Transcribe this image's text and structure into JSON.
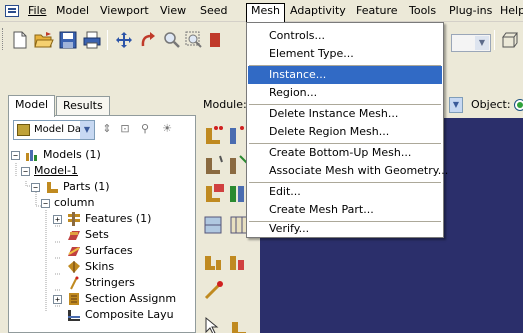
{
  "menubar": {
    "items": [
      {
        "label": "File"
      },
      {
        "label": "Model"
      },
      {
        "label": "Viewport"
      },
      {
        "label": "View"
      },
      {
        "label": "Seed"
      },
      {
        "label": "Mesh"
      },
      {
        "label": "Adaptivity"
      },
      {
        "label": "Feature"
      },
      {
        "label": "Tools"
      },
      {
        "label": "Plug-ins"
      },
      {
        "label": "Help"
      }
    ]
  },
  "mesh_menu": {
    "items": [
      {
        "label": "Controls..."
      },
      {
        "label": "Element Type..."
      },
      {
        "label": "Instance..."
      },
      {
        "label": "Region..."
      },
      {
        "label": "Delete Instance Mesh..."
      },
      {
        "label": "Delete Region Mesh..."
      },
      {
        "label": "Create Bottom-Up Mesh..."
      },
      {
        "label": "Associate Mesh with Geometry..."
      },
      {
        "label": "Edit..."
      },
      {
        "label": "Create Mesh Part..."
      },
      {
        "label": "Verify..."
      }
    ],
    "highlighted": "Instance..."
  },
  "left_panel": {
    "tabs": [
      {
        "label": "Model"
      },
      {
        "label": "Results"
      }
    ],
    "combo_value": "Model Da",
    "tree": {
      "models": "Models (1)",
      "model1": "Model-1",
      "parts": "Parts (1)",
      "column": "column",
      "features": "Features (1)",
      "sets": "Sets",
      "surfaces": "Surfaces",
      "skins": "Skins",
      "stringers": "Stringers",
      "section_assignments": "Section Assignm",
      "composite_layups": "Composite Layu"
    }
  },
  "module_strip": {
    "module_label": "Module:",
    "object_label": "Object:"
  },
  "colors": {
    "viewport_bg": "#2b2f6b",
    "highlight": "#316ac5",
    "chrome": "#ece9d8"
  }
}
